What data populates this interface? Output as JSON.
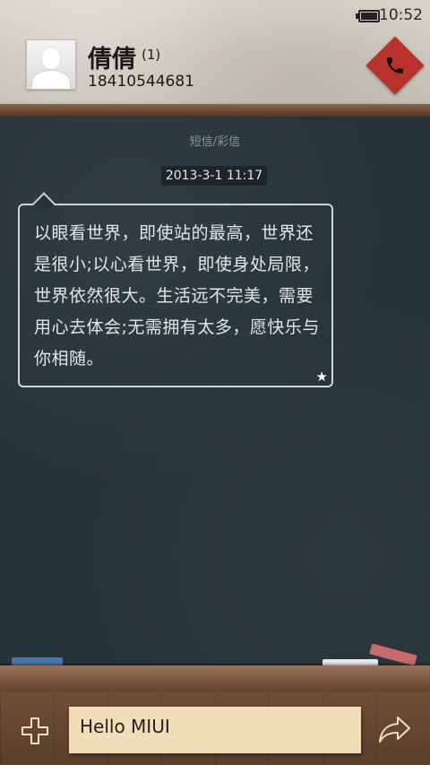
{
  "status": {
    "time": "10:52"
  },
  "contact": {
    "name": "倩倩",
    "count": "(1)",
    "phone": "18410544681"
  },
  "thread": {
    "type_label": "短信/彩信",
    "date": "2013-3-1 11:17",
    "messages": [
      {
        "text": "以眼看世界，即使站的最高，世界还是很小;以心看世界，即使身处局限，世界依然很大。生活远不完美，需要用心去体会;无需拥有太多，愿快乐与你相随。",
        "starred": true
      }
    ]
  },
  "composer": {
    "text": "Hello MIUI"
  },
  "colors": {
    "call_button": "#b8312c",
    "board": "#263338",
    "note_paper": "#f1ddb8"
  }
}
